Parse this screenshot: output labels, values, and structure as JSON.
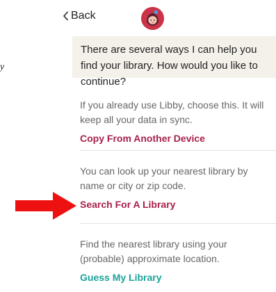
{
  "header": {
    "back_label": "Back",
    "back_icon": "chevron-left-icon",
    "avatar_icon": "libby-mascot-avatar"
  },
  "stray_glyph": "y",
  "bubble": {
    "text": "There are several ways I can help you find your library. How would you like to continue?"
  },
  "options": [
    {
      "description": "If you already use Libby, choose this. It will keep all your data in sync.",
      "link": "Copy From Another Device"
    },
    {
      "description": "You can look up your nearest library by name or city or zip code.",
      "link": "Search For A Library"
    },
    {
      "description": "Find the nearest library using your (probable) approximate location.",
      "link": "Guess My Library"
    }
  ],
  "annotation": {
    "icon": "right-arrow-icon"
  },
  "colors": {
    "bubble_bg": "#f4f1ea",
    "link_primary": "#a8214b",
    "link_guess": "#1aa39a",
    "avatar": "#cc3348",
    "annotation_arrow": "#ee1111",
    "divider": "#e2e2e2"
  }
}
